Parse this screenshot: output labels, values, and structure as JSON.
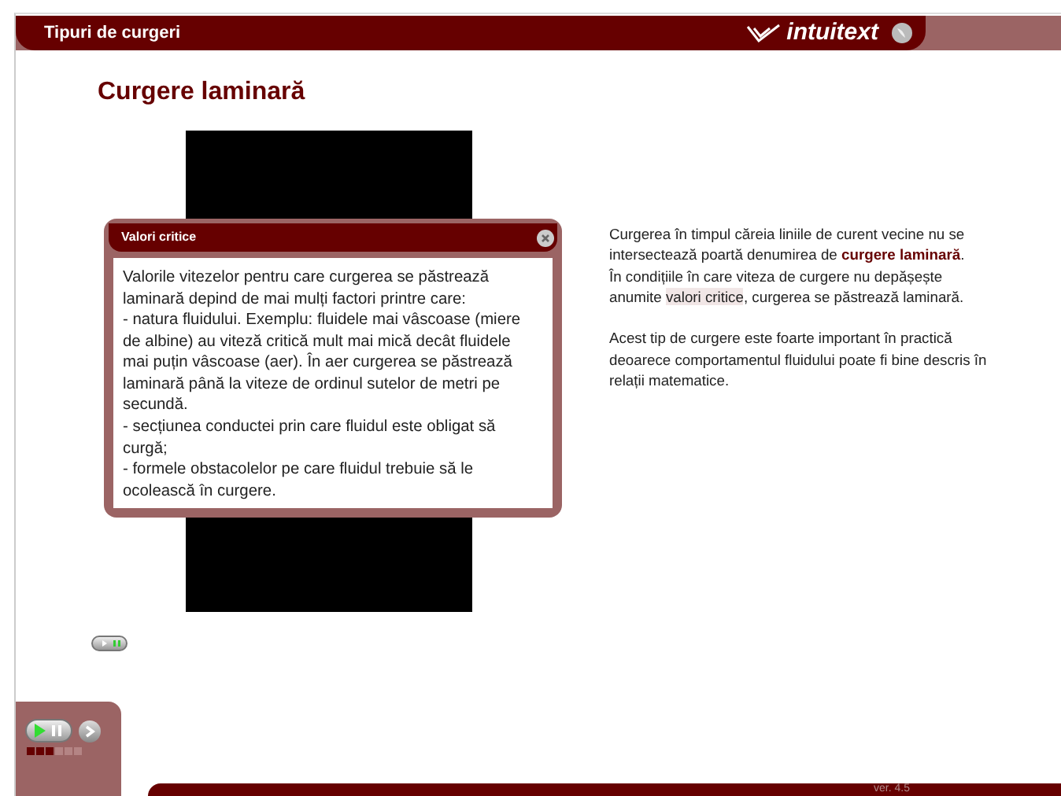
{
  "header": {
    "title": "Tipuri de curgeri",
    "brand": "intuitext"
  },
  "heading": "Curgere laminară",
  "popup": {
    "title": "Valori critice",
    "paragraphs": [
      "Valorile vitezelor pentru care curgerea se păstrează laminară depind de mai mulți factori printre care:",
      "- natura fluidului. Exemplu: fluidele mai vâscoase (miere de albine) au viteză critică mult mai mică decât fluidele mai puțin vâscoase (aer). În aer curgerea se păstrează laminară până la viteze de ordinul sutelor de metri pe secundă.",
      "- secțiunea conductei prin care fluidul este obligat să curgă;",
      "-  formele obstacolelor pe care fluidul trebuie să le ocolească în curgere."
    ]
  },
  "text": {
    "intro": "Curgerea în timpul căreia liniile de curent vecine nu se intersectează poartă denumirea de **curgere laminară**.",
    "before": "În condițiile în care viteza de curgere nu depășește anumite ",
    "link": "valori critice",
    "after": ", curgerea se păstrează laminară.",
    "closing": "Acest tip de curgere este foarte important în practică deoarece comportamentul fluidului poate fi bine descris în relații matematice."
  },
  "toggle": {
    "on": true
  },
  "progress": {
    "level": 0.5
  },
  "version": "ver. 4.5"
}
